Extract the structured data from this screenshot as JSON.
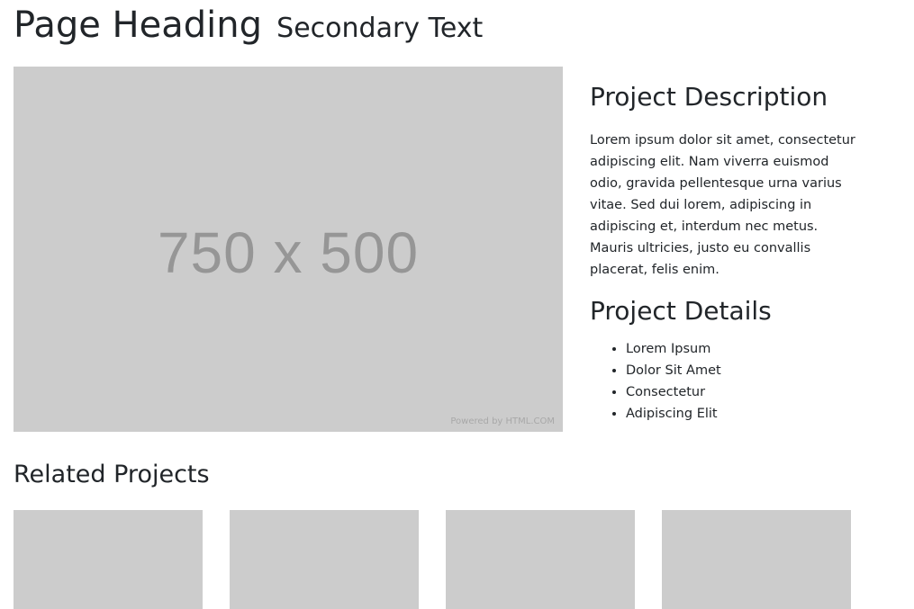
{
  "header": {
    "title": "Page Heading",
    "subtitle": "Secondary Text"
  },
  "hero": {
    "placeholder_text": "750 x 500",
    "powered_by": "Powered by HTML.COM"
  },
  "description": {
    "heading": "Project Description",
    "body": "Lorem ipsum dolor sit amet, consectetur adipiscing elit. Nam viverra euismod odio, gravida pellentesque urna varius vitae. Sed dui lorem, adipiscing in adipiscing et, interdum nec metus. Mauris ultricies, justo eu convallis placerat, felis enim."
  },
  "details": {
    "heading": "Project Details",
    "items": [
      "Lorem Ipsum",
      "Dolor Sit Amet",
      "Consectetur",
      "Adipiscing Elit"
    ]
  },
  "related": {
    "heading": "Related Projects",
    "thumbnail_count": 4
  },
  "colors": {
    "placeholder_bg": "#cccccc",
    "placeholder_text": "#969696",
    "text": "#212529"
  }
}
